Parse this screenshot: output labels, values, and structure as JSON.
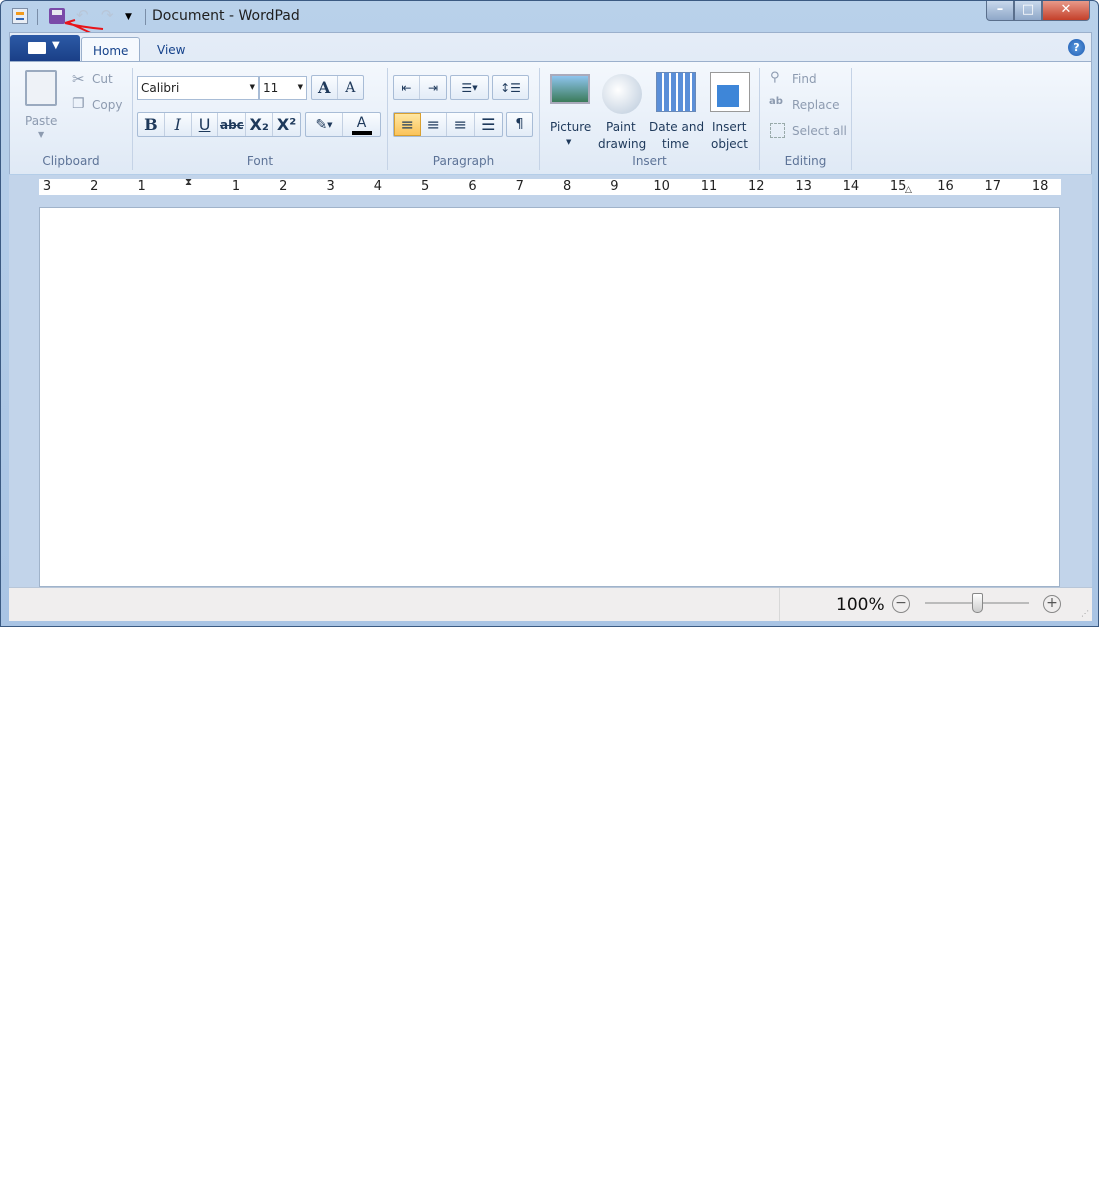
{
  "window": {
    "title": "Document - WordPad"
  },
  "quick_access": {
    "icons": [
      "wordpad-app-icon",
      "save-icon",
      "undo-icon",
      "redo-icon",
      "customize-dropdown-icon"
    ]
  },
  "tabs": [
    {
      "label": "Home",
      "active": true
    },
    {
      "label": "View",
      "active": false
    }
  ],
  "clipboard": {
    "paste": "Paste",
    "cut": "Cut",
    "copy": "Copy",
    "label": "Clipboard"
  },
  "font": {
    "family": "Calibri",
    "size": "11",
    "label": "Font",
    "buttons": [
      "B",
      "I",
      "U",
      "abc",
      "X₂",
      "X²"
    ],
    "grow": "A",
    "shrink": "A",
    "color_glyph": "A"
  },
  "paragraph": {
    "label": "Paragraph"
  },
  "insert": {
    "picture": "Picture",
    "paint_1": "Paint",
    "paint_2": "drawing",
    "date_1": "Date and",
    "date_2": "time",
    "object_1": "Insert",
    "object_2": "object",
    "label": "Insert"
  },
  "editing": {
    "find": "Find",
    "replace": "Replace",
    "select_all": "Select all",
    "label": "Editing"
  },
  "ruler": {
    "left": [
      "3",
      "2",
      "1"
    ],
    "right": [
      "1",
      "2",
      "3",
      "4",
      "5",
      "6",
      "7",
      "8",
      "9",
      "10",
      "11",
      "12",
      "13",
      "14",
      "15",
      "16",
      "17",
      "18"
    ]
  },
  "status": {
    "zoom": "100%",
    "zoom_slider_fraction": 0.5
  },
  "annotation": {
    "color": "#e8141a"
  }
}
